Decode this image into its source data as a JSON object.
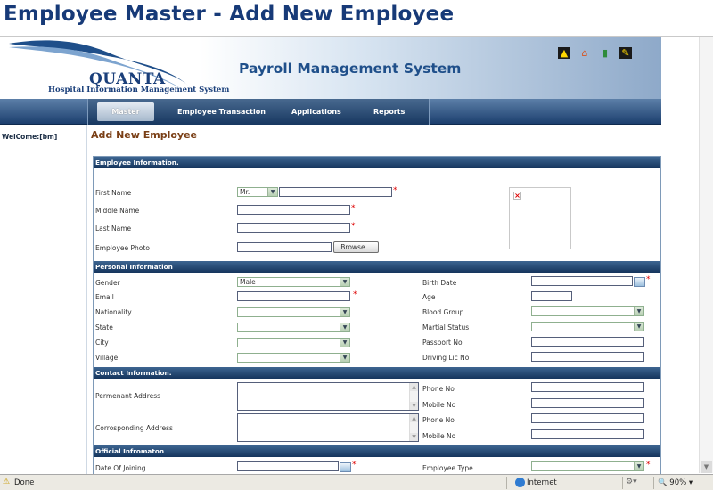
{
  "slide": {
    "title": "Employee Master  - Add New Employee"
  },
  "app": {
    "logo_big": "QUANTA",
    "logo_sub": "Hospital Information Management System",
    "title": "Payroll Management System",
    "header_icons": [
      "up-arrow-icon",
      "home-icon",
      "exit-door-icon",
      "edit-icon"
    ]
  },
  "nav": [
    "Master",
    "Employee Transaction",
    "Applications",
    "Reports"
  ],
  "sidebar": {
    "welcome": "WelCome:[bm]"
  },
  "page": {
    "heading": "Add New Employee"
  },
  "sections": {
    "employee_info": "Employee Information.",
    "personal_info": "Personal Information",
    "contact_info": "Contact Information.",
    "official_info": "Official Infromaton"
  },
  "employee": {
    "first_name_label": "First Name",
    "title_value": "Mr.",
    "middle_name_label": "Middle Name",
    "last_name_label": "Last Name",
    "photo_label": "Employee Photo",
    "browse": "Browse..."
  },
  "personal": {
    "gender_label": "Gender",
    "gender_value": "Male",
    "email_label": "Email",
    "nationality_label": "Nationality",
    "state_label": "State",
    "city_label": "City",
    "village_label": "Village",
    "birth_label": "Birth Date",
    "age_label": "Age",
    "blood_label": "Blood Group",
    "marital_label": "Martial Status",
    "passport_label": "Passport No",
    "driving_label": "Driving Lic No"
  },
  "contact": {
    "perm_label": "Permenant Address",
    "corr_label": "Corrosponding Address",
    "phone_label": "Phone No",
    "mobile_label": "Mobile No"
  },
  "official": {
    "doj_label": "Date Of Joining",
    "type_label": "Employee Type"
  },
  "required_mark": "*",
  "status": {
    "text": "Done",
    "zone": "Internet",
    "zoom": "90%"
  }
}
